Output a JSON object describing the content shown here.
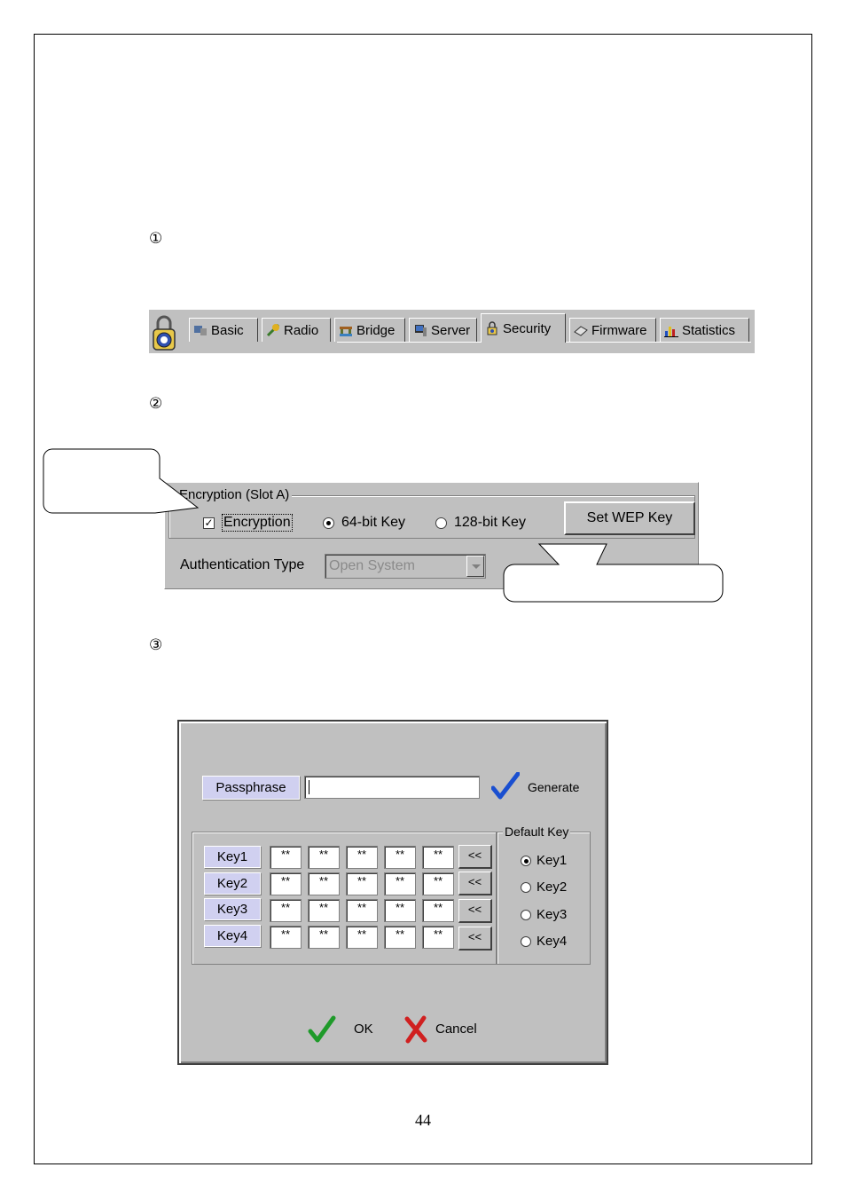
{
  "steps": [
    "①",
    "②",
    "③"
  ],
  "tabs": [
    {
      "label": "Basic",
      "icon": "basic-icon"
    },
    {
      "label": "Radio",
      "icon": "radio-icon"
    },
    {
      "label": "Bridge",
      "icon": "bridge-icon"
    },
    {
      "label": "Server",
      "icon": "server-icon"
    },
    {
      "label": "Security",
      "icon": "security-icon",
      "active": true
    },
    {
      "label": "Firmware",
      "icon": "firmware-icon"
    },
    {
      "label": "Statistics",
      "icon": "statistics-icon"
    }
  ],
  "encryption": {
    "group_title": "Encryption (Slot A)",
    "checkbox_label": "Encryption",
    "checked": true,
    "radio_64": "64-bit Key",
    "radio_128": "128-bit Key",
    "selected": "64-bit Key",
    "set_wep_button": "Set WEP Key",
    "auth_label": "Authentication Type",
    "auth_value": "Open System"
  },
  "dialog": {
    "passphrase_label": "Passphrase",
    "passphrase_value": "",
    "generate_label": "Generate",
    "keys": [
      {
        "label": "Key1",
        "bytes": [
          "**",
          "**",
          "**",
          "**",
          "**"
        ],
        "button": "<<"
      },
      {
        "label": "Key2",
        "bytes": [
          "**",
          "**",
          "**",
          "**",
          "**"
        ],
        "button": "<<"
      },
      {
        "label": "Key3",
        "bytes": [
          "**",
          "**",
          "**",
          "**",
          "**"
        ],
        "button": "<<"
      },
      {
        "label": "Key4",
        "bytes": [
          "**",
          "**",
          "**",
          "**",
          "**"
        ],
        "button": "<<"
      }
    ],
    "default_key_title": "Default Key",
    "default_key_options": [
      "Key1",
      "Key2",
      "Key3",
      "Key4"
    ],
    "default_key_selected": "Key1",
    "ok_label": "OK",
    "cancel_label": "Cancel"
  },
  "page_number": "44"
}
